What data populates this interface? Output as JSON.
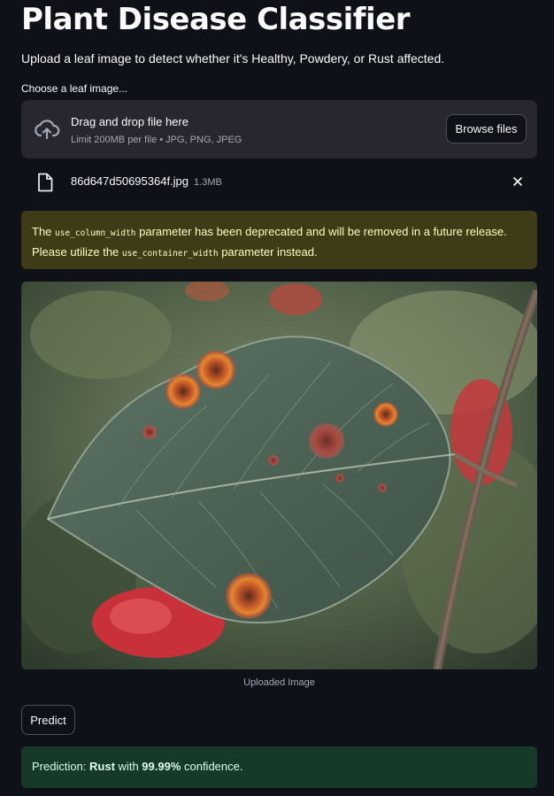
{
  "header": {
    "title": "Plant Disease Classifier",
    "subtitle": "Upload a leaf image to detect whether it's Healthy, Powdery, or Rust affected."
  },
  "uploader": {
    "label": "Choose a leaf image...",
    "drag_text": "Drag and drop file here",
    "limit_text": "Limit 200MB per file • JPG, PNG, JPEG",
    "browse_label": "Browse files",
    "upload_icon": "cloud-upload-icon"
  },
  "file": {
    "name": "86d647d50695364f.jpg",
    "size": "1.3MB",
    "icon": "file-icon"
  },
  "warning": {
    "text_1": "The ",
    "code_1": "use_column_width",
    "text_2": " parameter has been deprecated and will be removed in a future release. Please utilize the ",
    "code_2": "use_container_width",
    "text_3": " parameter instead."
  },
  "image": {
    "caption": "Uploaded Image"
  },
  "actions": {
    "predict_label": "Predict"
  },
  "result": {
    "prefix": "Prediction: ",
    "label": "Rust",
    "middle": " with ",
    "confidence": "99.99%",
    "suffix": " confidence."
  },
  "colors": {
    "background": "#0e1117",
    "widget_bg": "#262730",
    "warning_bg": "#3e3b16",
    "warning_text": "#ffffc2",
    "success_bg": "#173928",
    "success_text": "#dffde9"
  }
}
